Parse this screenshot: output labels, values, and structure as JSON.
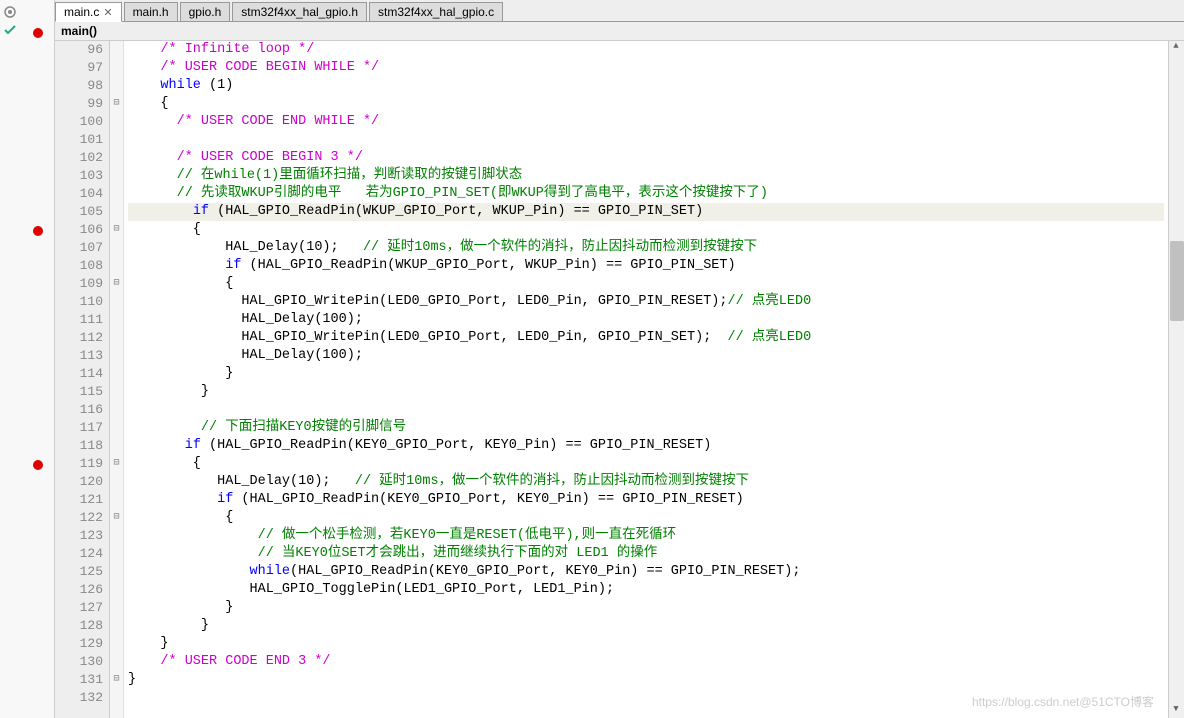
{
  "tabs": [
    {
      "label": "main.c",
      "active": true,
      "close": true
    },
    {
      "label": "main.h",
      "active": false
    },
    {
      "label": "gpio.h",
      "active": false
    },
    {
      "label": "stm32f4xx_hal_gpio.h",
      "active": false
    },
    {
      "label": "stm32f4xx_hal_gpio.c",
      "active": false
    }
  ],
  "breadcrumb": "main()",
  "line_start": 96,
  "line_end": 132,
  "fold_markers": {
    "99": "⊟",
    "106": "⊟",
    "109": "⊟",
    "119": "⊟",
    "122": "⊟",
    "131": "⊟"
  },
  "breakpoints": {
    "105": true,
    "118": true
  },
  "sidebar_markers": {
    "0": "gear",
    "1": "check",
    "4": "red-dot"
  },
  "code": [
    {
      "n": 96,
      "html": "    <span class='mcmnt'>/* Infinite loop */</span>"
    },
    {
      "n": 97,
      "html": "    <span class='mcmnt'>/* USER CODE BEGIN WHILE */</span>"
    },
    {
      "n": 98,
      "html": "    <span class='kw'>while</span> (1)"
    },
    {
      "n": 99,
      "html": "    {"
    },
    {
      "n": 100,
      "html": "      <span class='mcmnt'>/* USER CODE END WHILE */</span>"
    },
    {
      "n": 101,
      "html": ""
    },
    {
      "n": 102,
      "html": "      <span class='mcmnt'>/* USER CODE BEGIN 3 */</span>"
    },
    {
      "n": 103,
      "html": "      <span class='cmnt'>// 在while(1)里面循环扫描，判断读取的按键引脚状态</span>"
    },
    {
      "n": 104,
      "html": "      <span class='cmnt'>// 先读取WKUP引脚的电平   若为GPIO_PIN_SET(即WKUP得到了高电平，表示这个按键按下了)</span>"
    },
    {
      "n": 105,
      "hl": true,
      "html": "        <span class='kw'>if</span> (HAL_GPIO_ReadPin(WKUP_GPIO_Port, WKUP_Pin) == GPIO_PIN_SET)"
    },
    {
      "n": 106,
      "html": "        {"
    },
    {
      "n": 107,
      "html": "            HAL_Delay(10);   <span class='cmnt'>// 延时10ms，做一个软件的消抖，防止因抖动而检测到按键按下</span>"
    },
    {
      "n": 108,
      "html": "            <span class='kw'>if</span> (HAL_GPIO_ReadPin(WKUP_GPIO_Port, WKUP_Pin) == GPIO_PIN_SET)"
    },
    {
      "n": 109,
      "html": "            {"
    },
    {
      "n": 110,
      "html": "              HAL_GPIO_WritePin(LED0_GPIO_Port, LED0_Pin, GPIO_PIN_RESET);<span class='cmnt'>// 点亮LED0</span>"
    },
    {
      "n": 111,
      "html": "              HAL_Delay(100);"
    },
    {
      "n": 112,
      "html": "              HAL_GPIO_WritePin(LED0_GPIO_Port, LED0_Pin, GPIO_PIN_SET);  <span class='cmnt'>// 点亮LED0</span>"
    },
    {
      "n": 113,
      "html": "              HAL_Delay(100);"
    },
    {
      "n": 114,
      "html": "            }"
    },
    {
      "n": 115,
      "html": "         }"
    },
    {
      "n": 116,
      "html": ""
    },
    {
      "n": 117,
      "html": "         <span class='cmnt'>// 下面扫描KEY0按键的引脚信号</span>"
    },
    {
      "n": 118,
      "html": "       <span class='kw'>if</span> (HAL_GPIO_ReadPin(KEY0_GPIO_Port, KEY0_Pin) == GPIO_PIN_RESET)"
    },
    {
      "n": 119,
      "html": "        {"
    },
    {
      "n": 120,
      "html": "           HAL_Delay(10);   <span class='cmnt'>// 延时10ms，做一个软件的消抖，防止因抖动而检测到按键按下</span>"
    },
    {
      "n": 121,
      "html": "           <span class='kw'>if</span> (HAL_GPIO_ReadPin(KEY0_GPIO_Port, KEY0_Pin) == GPIO_PIN_RESET)"
    },
    {
      "n": 122,
      "html": "            {"
    },
    {
      "n": 123,
      "html": "                <span class='cmnt'>// 做一个松手检测，若KEY0一直是RESET(低电平),则一直在死循环</span>"
    },
    {
      "n": 124,
      "html": "                <span class='cmnt'>// 当KEY0位SET才会跳出，进而继续执行下面的对 LED1 的操作</span>"
    },
    {
      "n": 125,
      "html": "               <span class='kw'>while</span>(HAL_GPIO_ReadPin(KEY0_GPIO_Port, KEY0_Pin) == GPIO_PIN_RESET);"
    },
    {
      "n": 126,
      "html": "               HAL_GPIO_TogglePin(LED1_GPIO_Port, LED1_Pin);"
    },
    {
      "n": 127,
      "html": "            }"
    },
    {
      "n": 128,
      "html": "         }"
    },
    {
      "n": 129,
      "html": "    }"
    },
    {
      "n": 130,
      "html": "    <span class='mcmnt'>/* USER CODE END 3 */</span>"
    },
    {
      "n": 131,
      "html": "}"
    },
    {
      "n": 132,
      "html": ""
    }
  ],
  "watermark": "https://blog.csdn.net@51CTO博客"
}
